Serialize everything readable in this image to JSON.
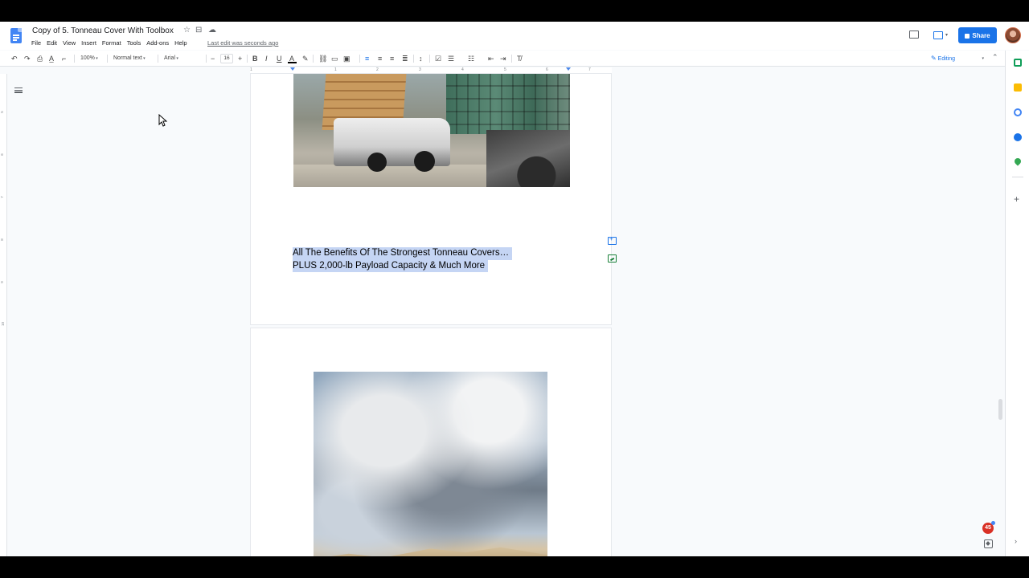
{
  "document": {
    "title": "Copy of 5. Tonneau Cover With Toolbox",
    "last_edit": "Last edit was seconds ago"
  },
  "menu": [
    "File",
    "Edit",
    "View",
    "Insert",
    "Format",
    "Tools",
    "Add-ons",
    "Help"
  ],
  "header": {
    "share_label": "Share",
    "accent_color": "#1a73e8"
  },
  "toolbar": {
    "zoom": "100%",
    "style": "Normal text",
    "font": "Arial",
    "font_size": "16",
    "mode": "Editing",
    "icons": [
      "undo-icon",
      "redo-icon",
      "print-icon",
      "spellcheck-icon",
      "paint-format-icon",
      "bold-icon",
      "italic-icon",
      "underline-icon",
      "text-color-icon",
      "highlight-icon",
      "link-icon",
      "comment-icon",
      "image-icon",
      "align-left-icon",
      "align-center-icon",
      "align-right-icon",
      "justify-icon",
      "line-spacing-icon",
      "checklist-icon",
      "bullet-list-icon",
      "numbered-list-icon",
      "decrease-indent-icon",
      "increase-indent-icon",
      "clear-formatting-icon"
    ]
  },
  "ruler": {
    "numbers": [
      "1",
      "1",
      "2",
      "3",
      "4",
      "5",
      "6",
      "7"
    ]
  },
  "vertical_ruler": {
    "numbers": [
      "5",
      "6",
      "7",
      "8",
      "9",
      "10"
    ]
  },
  "content": {
    "selected_lines": [
      "All The Benefits Of The Strongest Tonneau Covers…",
      "PLUS 2,000-lb Payload Capacity & Much More"
    ],
    "selection_color": "#c5d5f4"
  },
  "notifications": {
    "count": "45"
  }
}
